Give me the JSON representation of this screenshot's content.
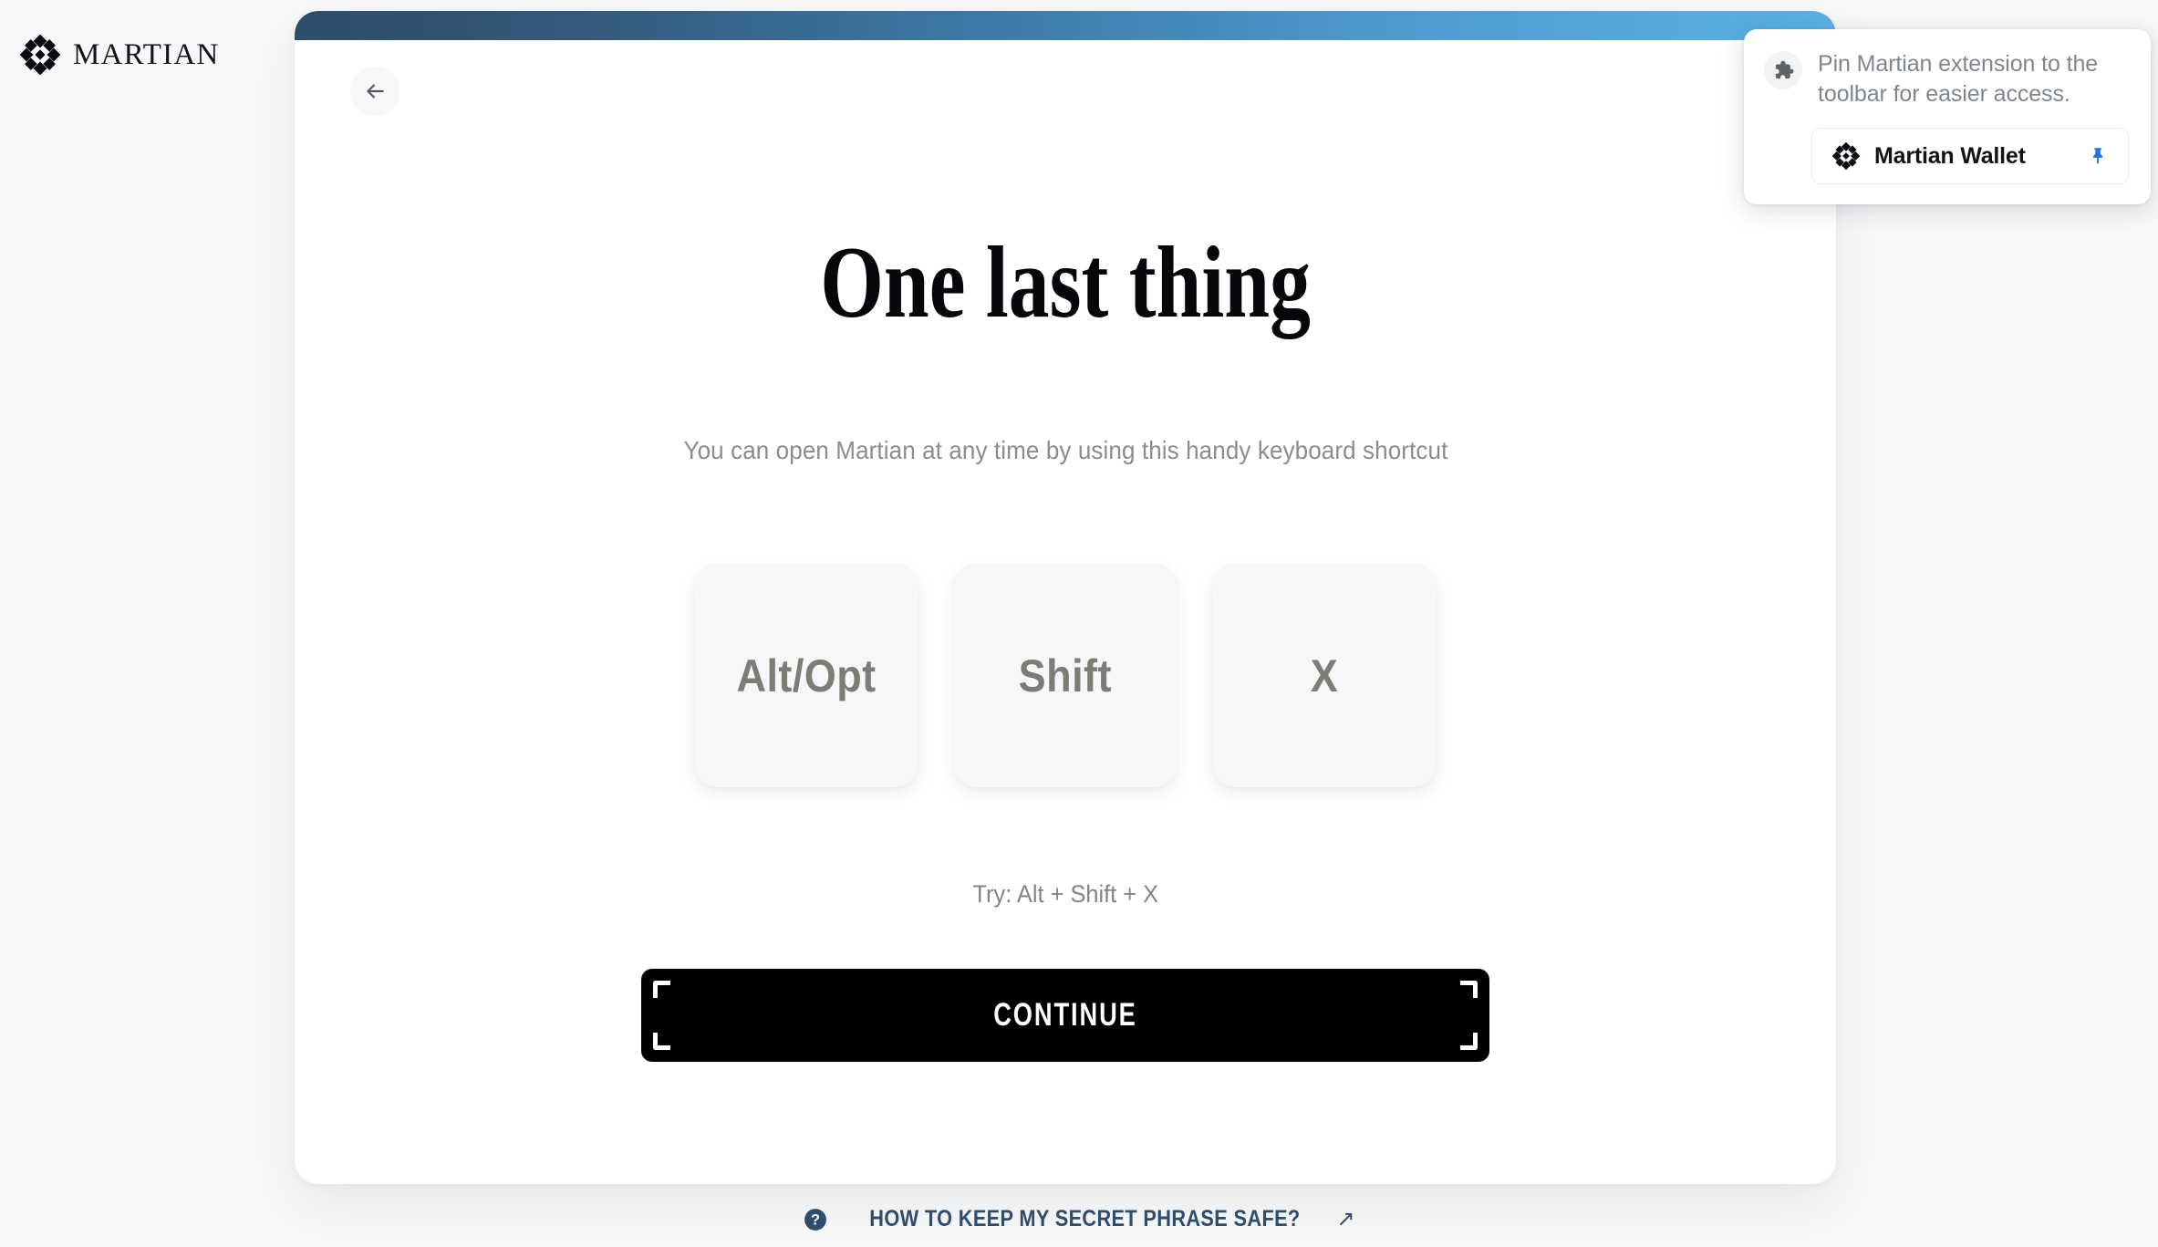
{
  "brand": {
    "name": "MARTIAN",
    "logo_icon": "martian-diamond-logo"
  },
  "card": {
    "accent_gradient_from": "#2d4d6b",
    "accent_gradient_to": "#5cb1e6",
    "back_button_icon": "arrow-left-icon",
    "headline": "One last thing",
    "subtitle": "You can open Martian at any time by using this handy keyboard shortcut",
    "keys": [
      {
        "label": "Alt/Opt"
      },
      {
        "label": "Shift"
      },
      {
        "label": "X"
      }
    ],
    "hint": "Try: Alt + Shift + X",
    "continue_label": "CONTINUE"
  },
  "footer": {
    "help_icon": "question-circle-icon",
    "link_text": "HOW TO KEEP MY SECRET PHRASE SAFE?",
    "external_arrow": "↗",
    "link_color": "#2e4d6c"
  },
  "pin_popup": {
    "puzzle_icon": "puzzle-piece-icon",
    "message": "Pin Martian extension to the toolbar for easier access.",
    "extension": {
      "logo_icon": "martian-diamond-logo",
      "name": "Martian Wallet",
      "pin_icon": "pushpin-icon",
      "pin_color": "#1a73e8"
    }
  }
}
